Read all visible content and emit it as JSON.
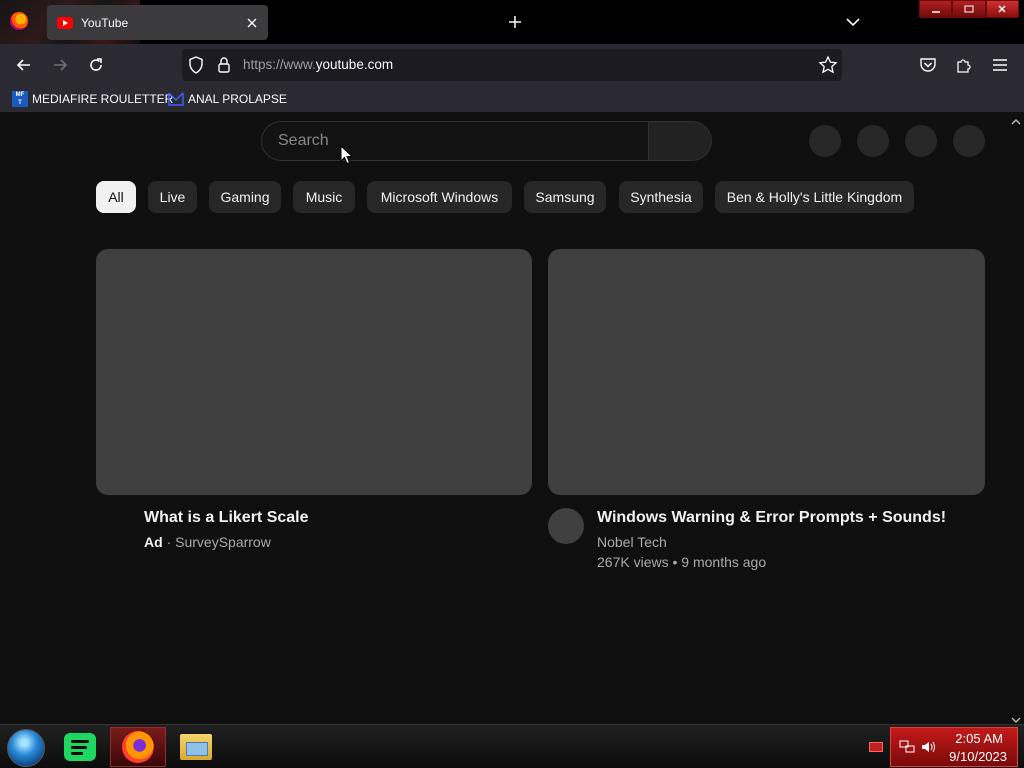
{
  "browser": {
    "tab": {
      "title": "YouTube"
    },
    "url": {
      "prefix": "https://www.",
      "host": "youtube.com"
    },
    "bookmarks": [
      {
        "icon": "mediafire-icon",
        "label": "MEDIAFIRE ROULETTER"
      },
      {
        "icon": "bookmark-star-icon",
        "label": "ANAL PROLAPSE"
      }
    ]
  },
  "youtube": {
    "search": {
      "placeholder": "Search"
    },
    "chips": [
      {
        "label": "All",
        "active": true
      },
      {
        "label": "Live"
      },
      {
        "label": "Gaming"
      },
      {
        "label": "Music"
      },
      {
        "label": "Microsoft Windows"
      },
      {
        "label": "Samsung"
      },
      {
        "label": "Synthesia"
      },
      {
        "label": "Ben & Holly's Little Kingdom"
      }
    ],
    "videos": [
      {
        "title": "What is a Likert Scale",
        "ad_badge": "Ad",
        "separator": "·",
        "channel": "SurveySparrow"
      },
      {
        "title": "Windows Warning & Error Prompts + Sounds!",
        "channel": "Nobel Tech",
        "views": "267K views",
        "separator": "•",
        "age": "9 months ago"
      }
    ]
  },
  "taskbar": {
    "apps": [
      "spotify-icon",
      "firefox-icon",
      "file-explorer-icon"
    ],
    "clock": {
      "time": "2:05 AM",
      "date": "9/10/2023"
    }
  },
  "colors": {
    "page_bg": "#0f0f0f",
    "chip_bg": "#272727",
    "chip_active_bg": "#f1f1f1",
    "skeleton": "#3f3f3f",
    "browser_toolbar": "#2b2a33",
    "taskbar_accent": "#c41a1a"
  }
}
